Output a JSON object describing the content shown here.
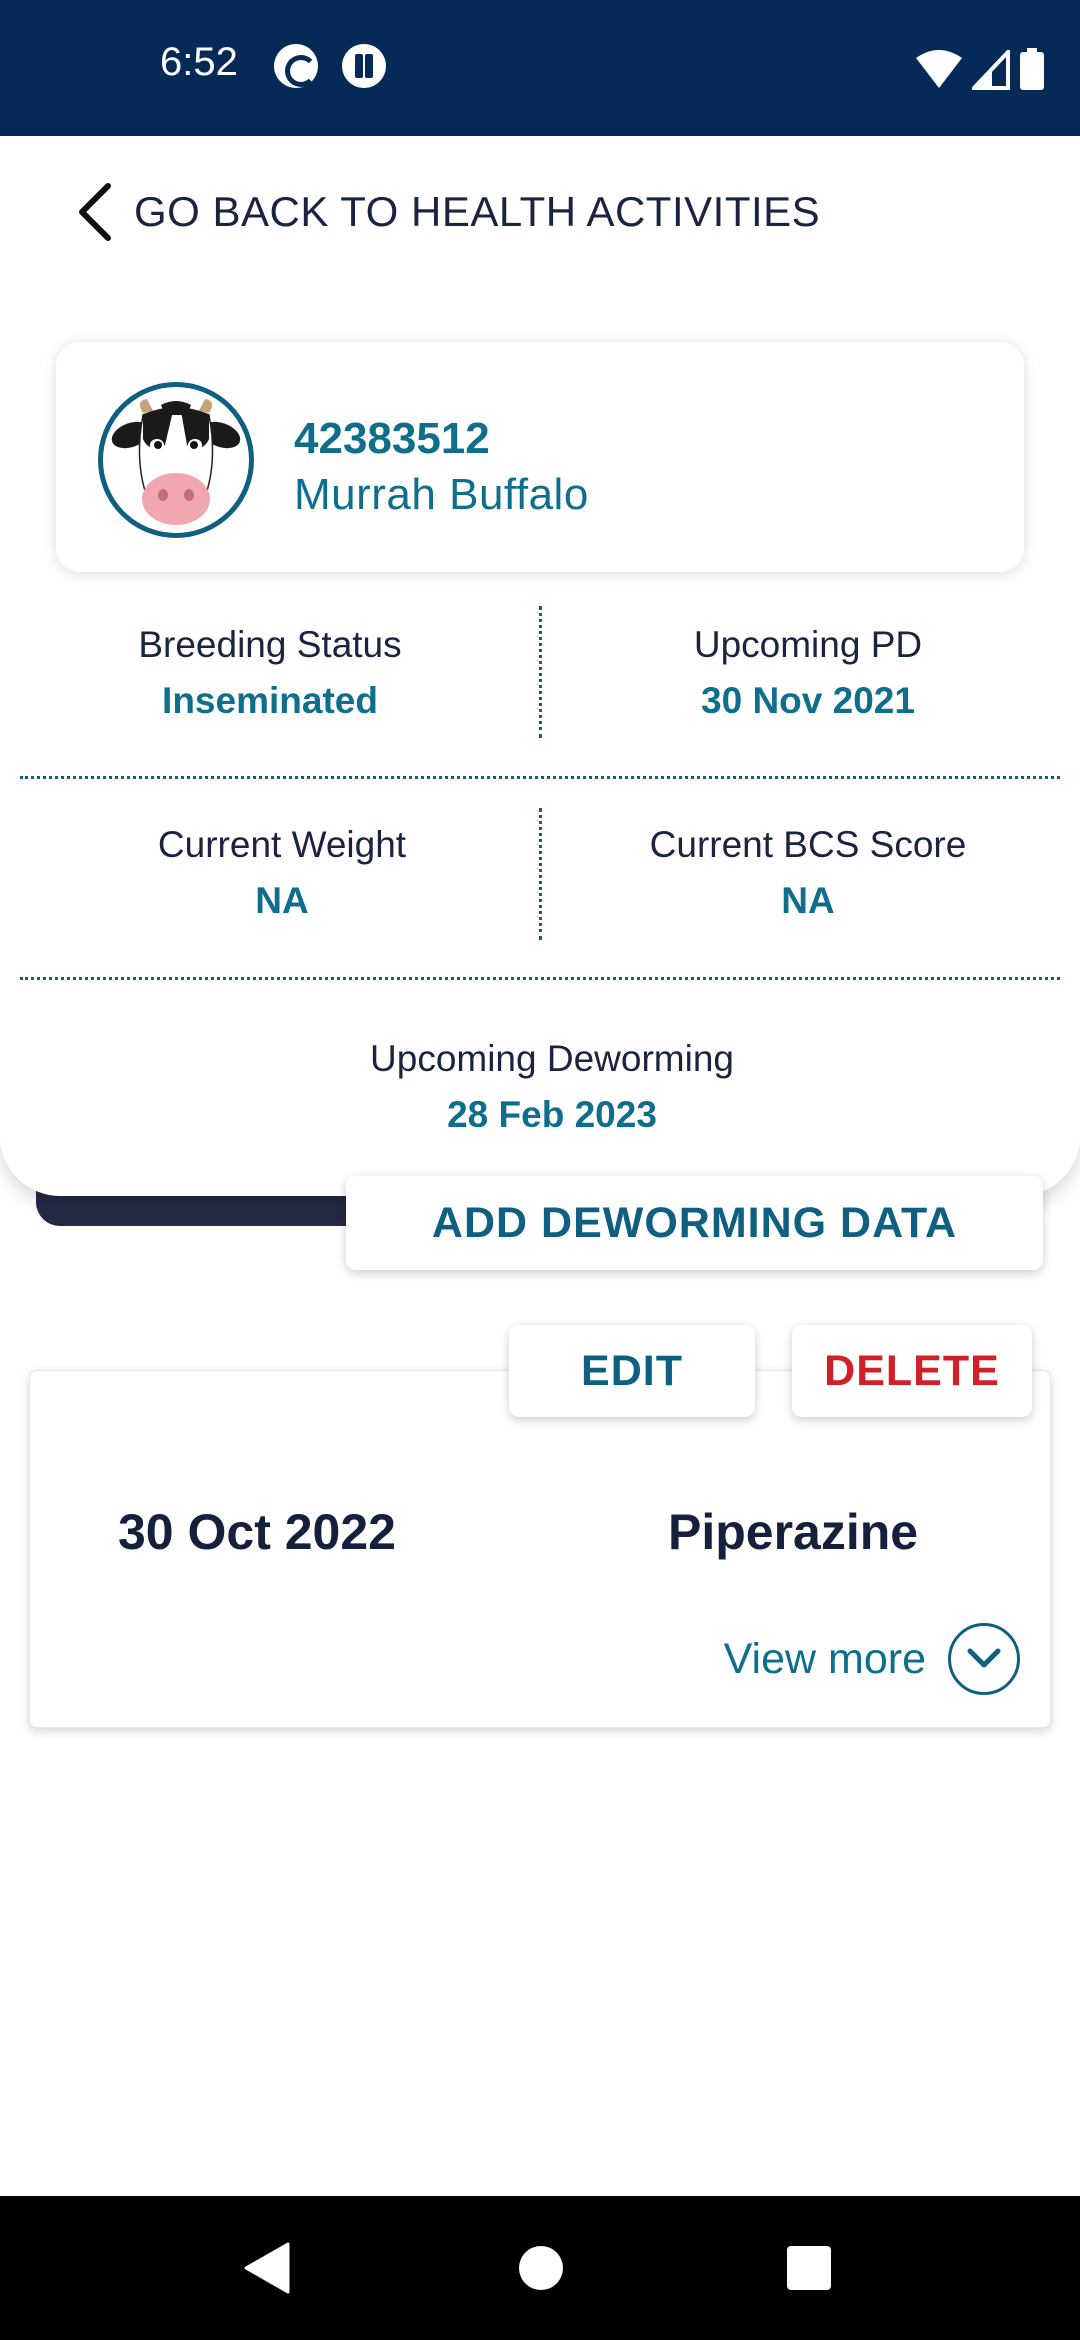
{
  "status_bar": {
    "time": "6:52",
    "icons": [
      "sync-icon",
      "app-icon",
      "wifi-icon",
      "signal-icon",
      "battery-icon"
    ]
  },
  "header": {
    "back_label": "GO BACK TO HEALTH ACTIVITIES"
  },
  "animal": {
    "id": "42383512",
    "name": "Murrah  Buffalo",
    "avatar_icon": "cow-face-icon"
  },
  "stats": {
    "breeding_status_label": "Breeding Status",
    "breeding_status_value": "Inseminated",
    "upcoming_pd_label": "Upcoming PD",
    "upcoming_pd_value": "30 Nov 2021",
    "current_weight_label": "Current Weight",
    "current_weight_value": "NA",
    "current_bcs_label": "Current BCS Score",
    "current_bcs_value": "NA",
    "upcoming_deworming_label": "Upcoming Deworming",
    "upcoming_deworming_value": "28 Feb 2023"
  },
  "actions": {
    "add_deworming": "ADD DEWORMING DATA",
    "edit": "EDIT",
    "delete": "DELETE"
  },
  "record": {
    "date": "30 Oct 2022",
    "medicine": "Piperazine",
    "view_more": "View more"
  },
  "colors": {
    "header_bg": "#062a57",
    "accent": "#0e6e8c",
    "delete": "#d0212a",
    "text_dark": "#1b2340"
  }
}
